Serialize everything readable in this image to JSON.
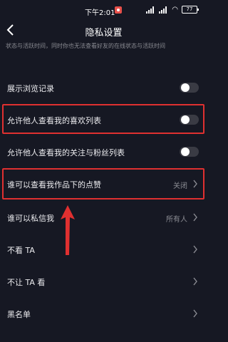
{
  "status_bar": {
    "time": "下午2:01",
    "battery": "77"
  },
  "header": {
    "title": "隐私设置"
  },
  "note": "状态与活跃时间，同时你也无法查看好友的在线状态与活跃时间",
  "rows": [
    {
      "label": "展示浏览记录",
      "control": "toggle",
      "on": false
    },
    {
      "label": "允许他人查看我的喜欢列表",
      "control": "toggle",
      "on": false
    },
    {
      "label": "允许他人查看我的关注与粉丝列表",
      "control": "toggle",
      "on": false
    },
    {
      "label": "谁可以查看我作品下的点赞",
      "control": "select",
      "value": "关闭"
    },
    {
      "label": "谁可以私信我",
      "control": "select",
      "value": "所有人"
    },
    {
      "label": "不看 TA",
      "control": "link"
    },
    {
      "label": "不让 TA 看",
      "control": "link"
    },
    {
      "label": "黑名单",
      "control": "link"
    }
  ],
  "colors": {
    "background": "#161823",
    "highlight": "#e03030",
    "toggle_off": "#3a3b44"
  }
}
